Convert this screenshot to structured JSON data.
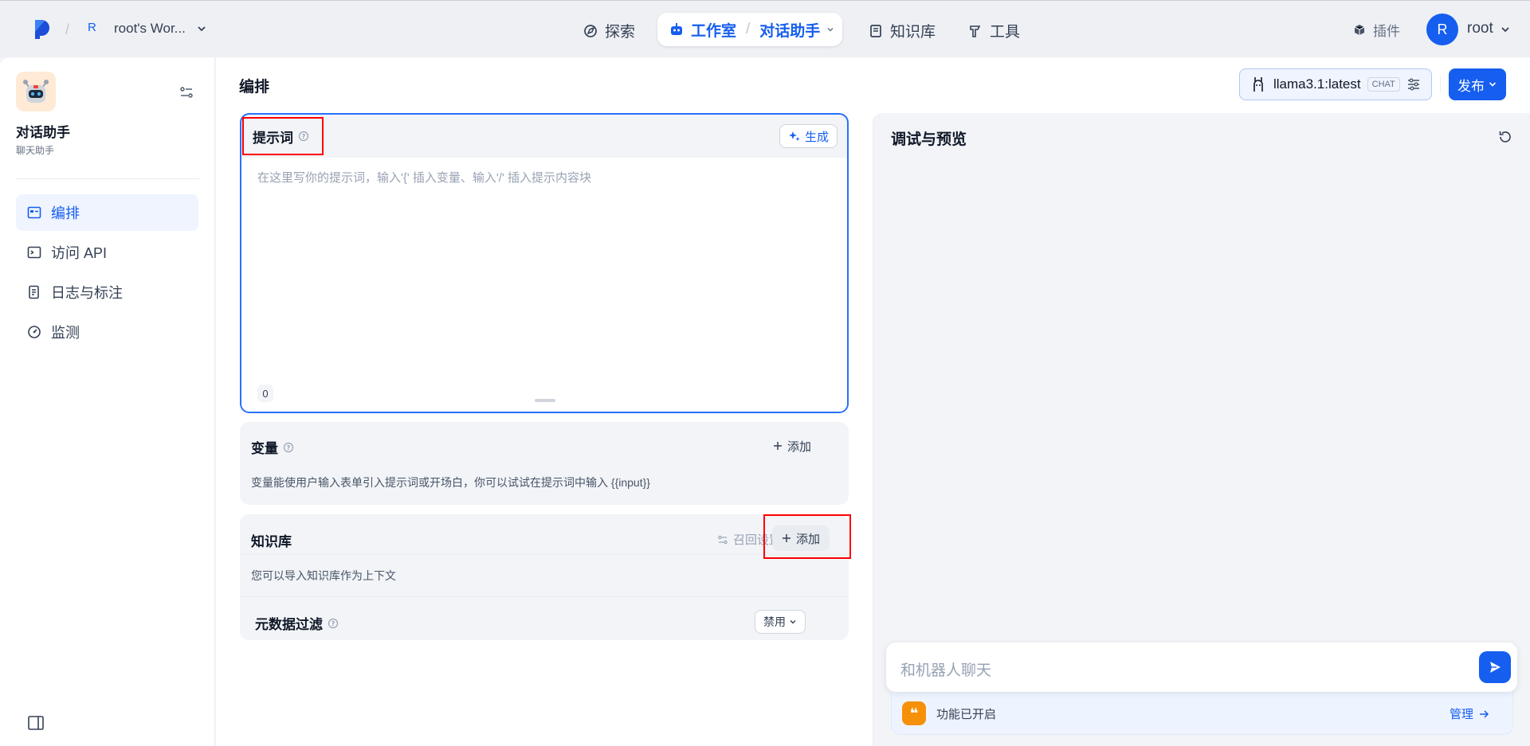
{
  "topbar": {
    "workspace_avatar": "R",
    "workspace_name": "root's Wor...",
    "nav": {
      "explore": "探索",
      "studio": "工作室",
      "current_app": "对话助手",
      "knowledge": "知识库",
      "tools": "工具"
    },
    "plugins": "插件",
    "user_avatar": "R",
    "user_name": "root"
  },
  "sidebar": {
    "app_name": "对话助手",
    "app_type": "聊天助手",
    "items": [
      {
        "label": "编排",
        "icon": "orchestrate-icon",
        "active": true
      },
      {
        "label": "访问 API",
        "icon": "terminal-icon",
        "active": false
      },
      {
        "label": "日志与标注",
        "icon": "log-icon",
        "active": false
      },
      {
        "label": "监测",
        "icon": "gauge-icon",
        "active": false
      }
    ]
  },
  "main": {
    "title": "编排",
    "model": {
      "name": "llama3.1:latest",
      "tag": "CHAT"
    },
    "publish": "发布",
    "prompt": {
      "title": "提示词",
      "generate": "生成",
      "placeholder": "在这里写你的提示词，输入'{' 插入变量、输入'/' 插入提示内容块",
      "count": "0"
    },
    "variables": {
      "title": "变量",
      "add": "添加",
      "desc": "变量能使用户输入表单引入提示词或开场白，你可以试试在提示词中输入 {{input}}"
    },
    "knowledge": {
      "title": "知识库",
      "recall": "召回设置",
      "add": "添加",
      "desc": "您可以导入知识库作为上下文",
      "metadata_title": "元数据过滤",
      "metadata_value": "禁用"
    }
  },
  "debug": {
    "title": "调试与预览",
    "chat_placeholder": "和机器人聊天",
    "feature_status": "功能已开启",
    "manage": "管理"
  },
  "colors": {
    "accent": "#155eef",
    "highlight_box": "#ff0000",
    "feature_icon": "#f79009"
  }
}
